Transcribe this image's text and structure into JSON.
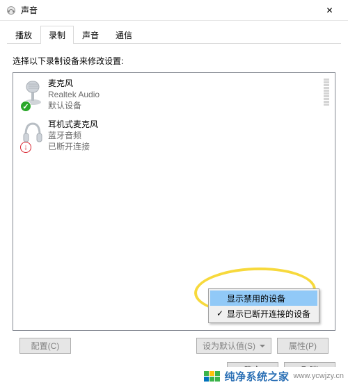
{
  "window": {
    "title": "声音",
    "close_glyph": "✕"
  },
  "tabs": [
    {
      "label": "播放"
    },
    {
      "label": "录制"
    },
    {
      "label": "声音"
    },
    {
      "label": "通信"
    }
  ],
  "instruction": "选择以下录制设备来修改设置:",
  "devices": [
    {
      "name": "麦克风",
      "manufacturer": "Realtek Audio",
      "status": "默认设备",
      "badge": "ok",
      "badge_glyph": "✓"
    },
    {
      "name": "耳机式麦克风",
      "manufacturer": "蓝牙音频",
      "status": "已断开连接",
      "badge": "err",
      "badge_glyph": "↓"
    }
  ],
  "context_menu": [
    {
      "label": "显示禁用的设备",
      "checked": false,
      "hover": true
    },
    {
      "label": "显示已断开连接的设备",
      "checked": true,
      "hover": false
    }
  ],
  "buttons": {
    "configure": "配置(C)",
    "set_default": "设为默认值(S)",
    "properties": "属性(P)",
    "ok": "确定",
    "cancel": "取消"
  },
  "watermark": {
    "brand": "纯净系统之家",
    "url": "www.ycwjzy.cn"
  },
  "colors": {
    "logo": [
      "#3bb44a",
      "#3bb44a",
      "#ffc20e",
      "#3bb44a",
      "#0072bc",
      "#3bb44a"
    ]
  }
}
